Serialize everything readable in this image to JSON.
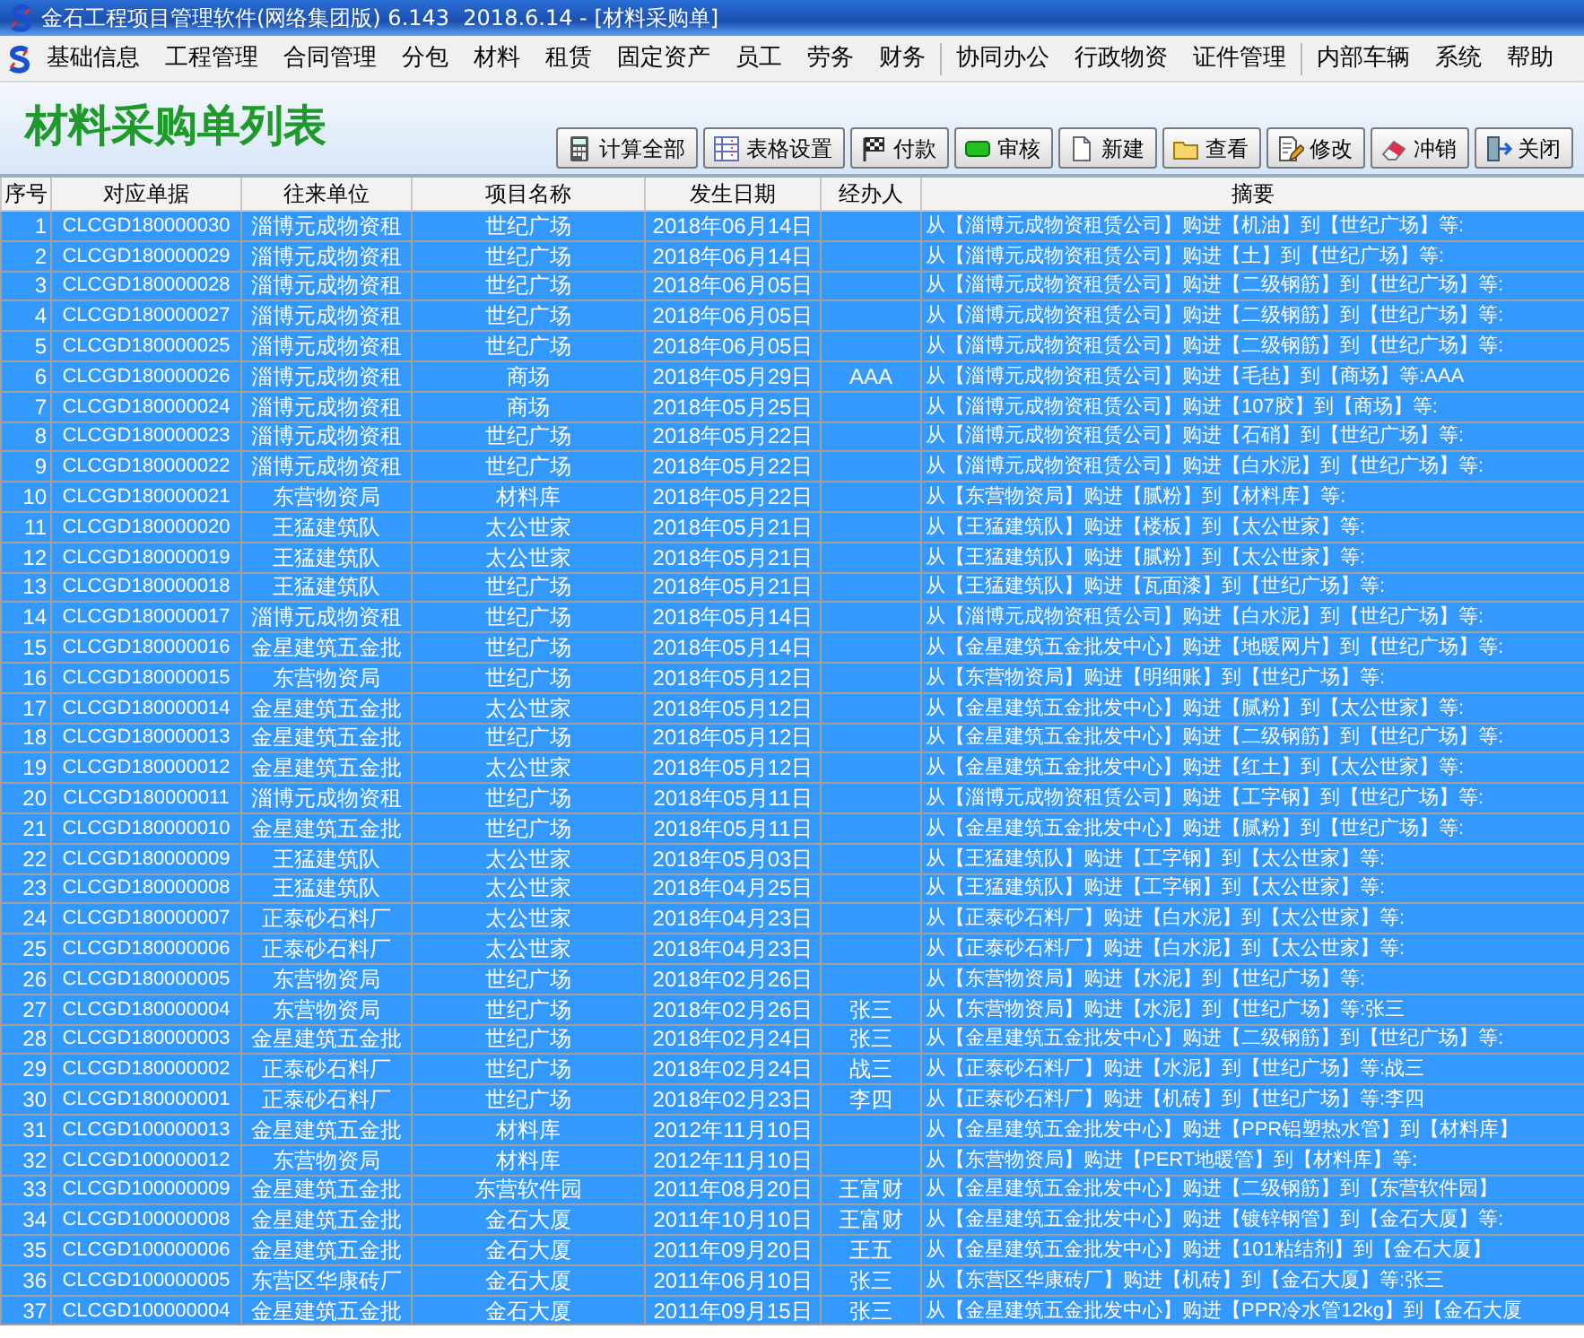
{
  "window": {
    "title": "金石工程项目管理软件(网络集团版) 6.143  2018.6.14 - [材料采购单]"
  },
  "menu": [
    "基础信息",
    "工程管理",
    "合同管理",
    "分包",
    "材料",
    "租赁",
    "固定资产",
    "员工",
    "劳务",
    "财务",
    "协同办公",
    "行政物资",
    "证件管理",
    "内部车辆",
    "系统",
    "帮助"
  ],
  "page_title": "材料采购单列表",
  "toolbar": [
    {
      "kind": "calculator",
      "label": "计算全部"
    },
    {
      "kind": "grid",
      "label": "表格设置"
    },
    {
      "kind": "flag",
      "label": "付款"
    },
    {
      "kind": "approve",
      "label": "审核"
    },
    {
      "kind": "document",
      "label": "新建"
    },
    {
      "kind": "folder",
      "label": "查看"
    },
    {
      "kind": "edit",
      "label": "修改"
    },
    {
      "kind": "eraser",
      "label": "冲销"
    },
    {
      "kind": "exit",
      "label": "关闭"
    }
  ],
  "table": {
    "columns": [
      "序号",
      "对应单据",
      "往来单位",
      "项目名称",
      "发生日期",
      "经办人",
      "摘要"
    ],
    "rows": [
      {
        "selected": true,
        "cells": [
          "1",
          "CLCGD180000030",
          "淄博元成物资租",
          "世纪广场",
          "2018年06月14日",
          "",
          "从【淄博元成物资租赁公司】购进【机油】到【世纪广场】等:"
        ]
      },
      {
        "selected": true,
        "cells": [
          "2",
          "CLCGD180000029",
          "淄博元成物资租",
          "世纪广场",
          "2018年06月14日",
          "",
          "从【淄博元成物资租赁公司】购进【土】到【世纪广场】等:"
        ]
      },
      {
        "selected": true,
        "cells": [
          "3",
          "CLCGD180000028",
          "淄博元成物资租",
          "世纪广场",
          "2018年06月05日",
          "",
          "从【淄博元成物资租赁公司】购进【二级钢筋】到【世纪广场】等:"
        ]
      },
      {
        "selected": true,
        "cells": [
          "4",
          "CLCGD180000027",
          "淄博元成物资租",
          "世纪广场",
          "2018年06月05日",
          "",
          "从【淄博元成物资租赁公司】购进【二级钢筋】到【世纪广场】等:"
        ]
      },
      {
        "selected": true,
        "cells": [
          "5",
          "CLCGD180000025",
          "淄博元成物资租",
          "世纪广场",
          "2018年06月05日",
          "",
          "从【淄博元成物资租赁公司】购进【二级钢筋】到【世纪广场】等:"
        ]
      },
      {
        "selected": true,
        "cells": [
          "6",
          "CLCGD180000026",
          "淄博元成物资租",
          "商场",
          "2018年05月29日",
          "AAA",
          "从【淄博元成物资租赁公司】购进【毛毡】到【商场】等:AAA"
        ]
      },
      {
        "selected": true,
        "cells": [
          "7",
          "CLCGD180000024",
          "淄博元成物资租",
          "商场",
          "2018年05月25日",
          "",
          "从【淄博元成物资租赁公司】购进【107胶】到【商场】等:"
        ]
      },
      {
        "selected": true,
        "cells": [
          "8",
          "CLCGD180000023",
          "淄博元成物资租",
          "世纪广场",
          "2018年05月22日",
          "",
          "从【淄博元成物资租赁公司】购进【石硝】到【世纪广场】等:"
        ]
      },
      {
        "selected": true,
        "cells": [
          "9",
          "CLCGD180000022",
          "淄博元成物资租",
          "世纪广场",
          "2018年05月22日",
          "",
          "从【淄博元成物资租赁公司】购进【白水泥】到【世纪广场】等:"
        ]
      },
      {
        "selected": true,
        "cells": [
          "10",
          "CLCGD180000021",
          "东营物资局",
          "材料库",
          "2018年05月22日",
          "",
          "从【东营物资局】购进【腻粉】到【材料库】等:"
        ]
      },
      {
        "selected": true,
        "cells": [
          "11",
          "CLCGD180000020",
          "王猛建筑队",
          "太公世家",
          "2018年05月21日",
          "",
          "从【王猛建筑队】购进【楼板】到【太公世家】等:"
        ]
      },
      {
        "selected": true,
        "cells": [
          "12",
          "CLCGD180000019",
          "王猛建筑队",
          "太公世家",
          "2018年05月21日",
          "",
          "从【王猛建筑队】购进【腻粉】到【太公世家】等:"
        ]
      },
      {
        "selected": true,
        "cells": [
          "13",
          "CLCGD180000018",
          "王猛建筑队",
          "世纪广场",
          "2018年05月21日",
          "",
          "从【王猛建筑队】购进【瓦面漆】到【世纪广场】等:"
        ]
      },
      {
        "selected": true,
        "cells": [
          "14",
          "CLCGD180000017",
          "淄博元成物资租",
          "世纪广场",
          "2018年05月14日",
          "",
          "从【淄博元成物资租赁公司】购进【白水泥】到【世纪广场】等:"
        ]
      },
      {
        "selected": true,
        "cells": [
          "15",
          "CLCGD180000016",
          "金星建筑五金批",
          "世纪广场",
          "2018年05月14日",
          "",
          "从【金星建筑五金批发中心】购进【地暖网片】到【世纪广场】等:"
        ]
      },
      {
        "selected": true,
        "cells": [
          "16",
          "CLCGD180000015",
          "东营物资局",
          "世纪广场",
          "2018年05月12日",
          "",
          "从【东营物资局】购进【明细账】到【世纪广场】等:"
        ]
      },
      {
        "selected": true,
        "cells": [
          "17",
          "CLCGD180000014",
          "金星建筑五金批",
          "太公世家",
          "2018年05月12日",
          "",
          "从【金星建筑五金批发中心】购进【腻粉】到【太公世家】等:"
        ]
      },
      {
        "selected": true,
        "cells": [
          "18",
          "CLCGD180000013",
          "金星建筑五金批",
          "世纪广场",
          "2018年05月12日",
          "",
          "从【金星建筑五金批发中心】购进【二级钢筋】到【世纪广场】等:"
        ]
      },
      {
        "selected": true,
        "cells": [
          "19",
          "CLCGD180000012",
          "金星建筑五金批",
          "太公世家",
          "2018年05月12日",
          "",
          "从【金星建筑五金批发中心】购进【红土】到【太公世家】等:"
        ]
      },
      {
        "selected": true,
        "cells": [
          "20",
          "CLCGD180000011",
          "淄博元成物资租",
          "世纪广场",
          "2018年05月11日",
          "",
          "从【淄博元成物资租赁公司】购进【工字钢】到【世纪广场】等:"
        ]
      },
      {
        "selected": true,
        "cells": [
          "21",
          "CLCGD180000010",
          "金星建筑五金批",
          "世纪广场",
          "2018年05月11日",
          "",
          "从【金星建筑五金批发中心】购进【腻粉】到【世纪广场】等:"
        ]
      },
      {
        "selected": true,
        "cells": [
          "22",
          "CLCGD180000009",
          "王猛建筑队",
          "太公世家",
          "2018年05月03日",
          "",
          "从【王猛建筑队】购进【工字钢】到【太公世家】等:"
        ]
      },
      {
        "selected": true,
        "cells": [
          "23",
          "CLCGD180000008",
          "王猛建筑队",
          "太公世家",
          "2018年04月25日",
          "",
          "从【王猛建筑队】购进【工字钢】到【太公世家】等:"
        ]
      },
      {
        "selected": true,
        "cells": [
          "24",
          "CLCGD180000007",
          "正泰砂石料厂",
          "太公世家",
          "2018年04月23日",
          "",
          "从【正泰砂石料厂】购进【白水泥】到【太公世家】等:"
        ]
      },
      {
        "selected": true,
        "cells": [
          "25",
          "CLCGD180000006",
          "正泰砂石料厂",
          "太公世家",
          "2018年04月23日",
          "",
          "从【正泰砂石料厂】购进【白水泥】到【太公世家】等:"
        ]
      },
      {
        "selected": true,
        "cells": [
          "26",
          "CLCGD180000005",
          "东营物资局",
          "世纪广场",
          "2018年02月26日",
          "",
          "从【东营物资局】购进【水泥】到【世纪广场】等:"
        ]
      },
      {
        "selected": true,
        "cells": [
          "27",
          "CLCGD180000004",
          "东营物资局",
          "世纪广场",
          "2018年02月26日",
          "张三",
          "从【东营物资局】购进【水泥】到【世纪广场】等:张三"
        ]
      },
      {
        "selected": true,
        "cells": [
          "28",
          "CLCGD180000003",
          "金星建筑五金批",
          "世纪广场",
          "2018年02月24日",
          "张三",
          "从【金星建筑五金批发中心】购进【二级钢筋】到【世纪广场】等:"
        ]
      },
      {
        "selected": true,
        "cells": [
          "29",
          "CLCGD180000002",
          "正泰砂石料厂",
          "世纪广场",
          "2018年02月24日",
          "战三",
          "从【正泰砂石料厂】购进【水泥】到【世纪广场】等:战三"
        ]
      },
      {
        "selected": true,
        "cells": [
          "30",
          "CLCGD180000001",
          "正泰砂石料厂",
          "世纪广场",
          "2018年02月23日",
          "李四",
          "从【正泰砂石料厂】购进【机砖】到【世纪广场】等:李四"
        ]
      },
      {
        "selected": true,
        "cells": [
          "31",
          "CLCGD100000013",
          "金星建筑五金批",
          "材料库",
          "2012年11月10日",
          "",
          "从【金星建筑五金批发中心】购进【PPR铝塑热水管】到【材料库】"
        ]
      },
      {
        "selected": true,
        "cells": [
          "32",
          "CLCGD100000012",
          "东营物资局",
          "材料库",
          "2012年11月10日",
          "",
          "从【东营物资局】购进【PERT地暖管】到【材料库】等:"
        ]
      },
      {
        "selected": true,
        "cells": [
          "33",
          "CLCGD100000009",
          "金星建筑五金批",
          "东营软件园",
          "2011年08月20日",
          "王富财",
          "从【金星建筑五金批发中心】购进【二级钢筋】到【东营软件园】"
        ]
      },
      {
        "selected": true,
        "cells": [
          "34",
          "CLCGD100000008",
          "金星建筑五金批",
          "金石大厦",
          "2011年10月10日",
          "王富财",
          "从【金星建筑五金批发中心】购进【镀锌钢管】到【金石大厦】等:"
        ]
      },
      {
        "selected": true,
        "cells": [
          "35",
          "CLCGD100000006",
          "金星建筑五金批",
          "金石大厦",
          "2011年09月20日",
          "王五",
          "从【金星建筑五金批发中心】购进【101粘结剂】到【金石大厦】"
        ]
      },
      {
        "selected": true,
        "cells": [
          "36",
          "CLCGD100000005",
          "东营区华康砖厂",
          "金石大厦",
          "2011年06月10日",
          "张三",
          "从【东营区华康砖厂】购进【机砖】到【金石大厦】等:张三"
        ]
      },
      {
        "selected": true,
        "cells": [
          "37",
          "CLCGD100000004",
          "金星建筑五金批",
          "金石大厦",
          "2011年09月15日",
          "张三",
          "从【金星建筑五金批发中心】购进【PPR冷水管12kg】到【金石大厦"
        ]
      }
    ]
  }
}
